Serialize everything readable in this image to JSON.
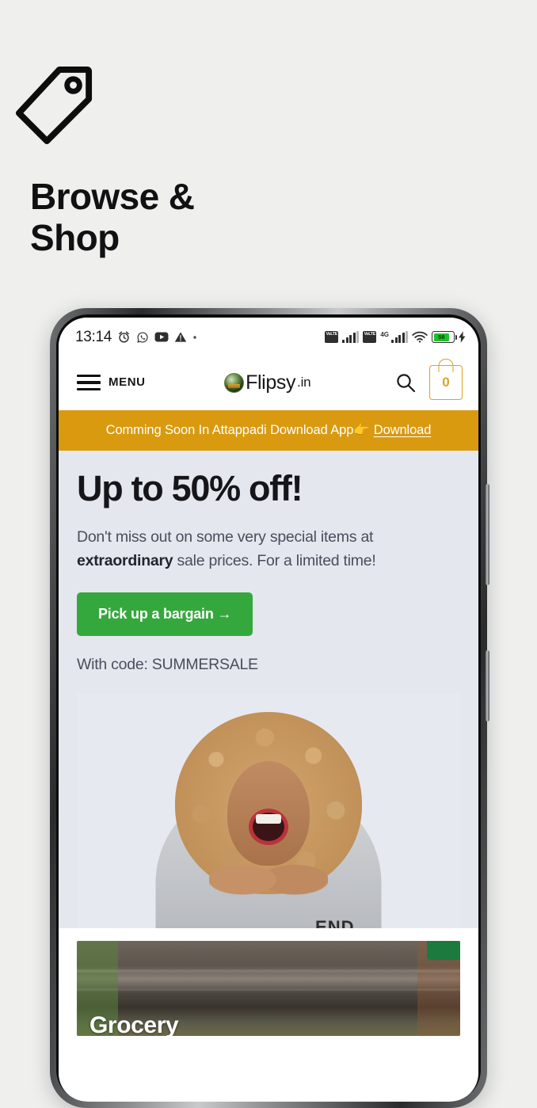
{
  "promo": {
    "icon": "price-tag-icon",
    "title_line1": "Browse &",
    "title_line2": "Shop"
  },
  "phone": {
    "status_bar": {
      "time": "13:14",
      "left_icons": [
        "alarm-clock-icon",
        "whatsapp-icon",
        "youtube-icon",
        "warning-triangle-icon",
        "dot-icon"
      ],
      "sim1_label": "VoLTE",
      "sim2_label": "VoLTE",
      "network_type": "4G",
      "wifi": "wifi-icon",
      "battery_percent": "58",
      "charging": true
    },
    "navbar": {
      "menu_label": "MENU",
      "brand_name": "Flipsy",
      "brand_tld": ".in",
      "search_icon": "search-icon",
      "cart_count": "0"
    },
    "announcement": {
      "text": "Comming Soon In Attappadi Download App👉",
      "link_label": "Download",
      "bg_color": "#d99a10"
    },
    "hero": {
      "headline": "Up to 50% off!",
      "sub_part1": "Don't miss out on some very special items at ",
      "sub_bold": "extraordinary",
      "sub_part2": " sale prices. For a limited time!",
      "cta_label": "Pick up a bargain →",
      "cta_color": "#34a83d",
      "code_text": "With code: SUMMERSALE",
      "bg_color": "#e4e7ee",
      "photo_alt": "laughing-woman-hoodie-photo"
    },
    "category_card": {
      "name": "Grocery",
      "badge_color": "#1d7a3e"
    }
  }
}
